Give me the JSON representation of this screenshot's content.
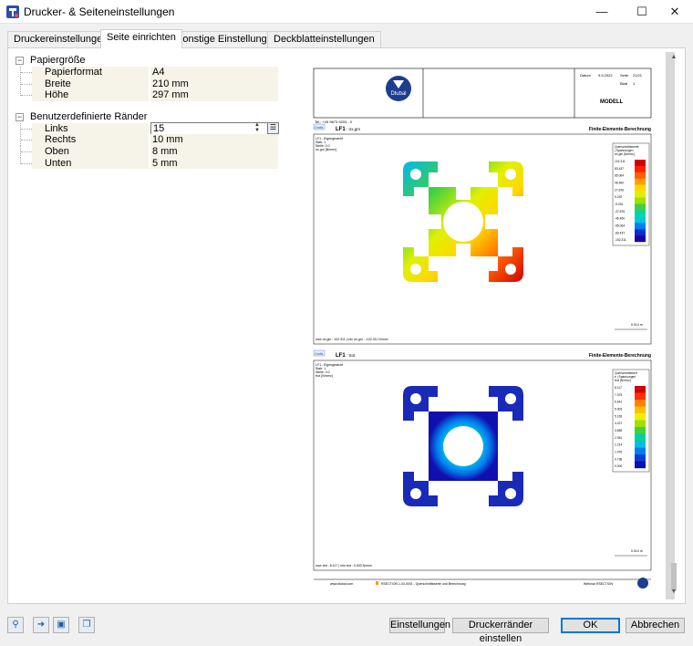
{
  "window": {
    "title": "Drucker- & Seiteneinstellungen",
    "minimize_glyph": "—",
    "maximize_glyph": "☐",
    "close_glyph": "✕"
  },
  "tabs": [
    {
      "label": "Druckereinstellungen"
    },
    {
      "label": "Seite einrichten"
    },
    {
      "label": "Sonstige Einstellungen"
    },
    {
      "label": "Deckblatteinstellungen"
    }
  ],
  "tree": {
    "paper": {
      "label": "Papiergröße",
      "toggle": "−",
      "rows": [
        {
          "key": "Papierformat",
          "value": "A4"
        },
        {
          "key": "Breite",
          "value": "210 mm"
        },
        {
          "key": "Höhe",
          "value": "297 mm"
        }
      ]
    },
    "margins": {
      "label": "Benutzerdefinierte Ränder",
      "toggle": "−",
      "rows": [
        {
          "key": "Links",
          "value": "15"
        },
        {
          "key": "Rechts",
          "value": "10 mm"
        },
        {
          "key": "Oben",
          "value": "8 mm"
        },
        {
          "key": "Unten",
          "value": "5 mm"
        }
      ]
    }
  },
  "preview": {
    "header": {
      "company": "Dlubal",
      "tel": "Tel.: +49 9673 9203 - 0",
      "datum_label": "Datum",
      "datum_value": "9.5.2022",
      "seite_label": "Seite",
      "seite_value": "21/21",
      "blatt_label": "Blatt",
      "blatt_value": "1",
      "modell": "MODELL"
    },
    "section1": {
      "badge": "Grafik",
      "lf": "LF1",
      "sym": ": σx,gm",
      "right": "Finite-Elemente-Berechnung",
      "info": [
        "LF1 - Eigengewicht",
        "Stab: 1",
        "Stelle: 0.0",
        "σx,gm [N/mm²]"
      ],
      "legend_title": [
        "Querschnittswerte",
        "| Spannungen",
        "σx,gm [N/mm²]"
      ],
      "legend_values": [
        "102.311",
        "83.437",
        "65.064",
        "46.460",
        "27.876",
        "9.292",
        "-9.292",
        "-27.876",
        "-46.460",
        "-65.064",
        "-83.437",
        "-102.311"
      ],
      "colors": [
        "#d40000",
        "#ff2000",
        "#ff6000",
        "#ffa000",
        "#ffd800",
        "#e0f000",
        "#a0e000",
        "#40d040",
        "#00d8a0",
        "#00c8e0",
        "#0080f0",
        "#0030d0",
        "#2000a0"
      ],
      "scale": "0.014 m",
      "footer": "max σx,gm : 102.311 | min σx,gm : -102.311 N/mm²"
    },
    "section2": {
      "badge": "Grafik",
      "lf": "LF1",
      "sym": ": τtot",
      "right": "Finite-Elemente-Berechnung",
      "info": [
        "LF1 - Eigengewicht",
        "Stab: 1",
        "Stelle: 0.0",
        "τtot [N/mm²]"
      ],
      "legend_title": [
        "Querschnittswert",
        "e | Spannungen",
        "τtot [N/mm²]"
      ],
      "legend_values": [
        "8.117",
        "7.379",
        "6.641",
        "5.903",
        "5.165",
        "4.427",
        "3.689",
        "2.951",
        "2.214",
        "1.476",
        "0.738",
        "0.000"
      ],
      "colors": [
        "#d40000",
        "#ff3000",
        "#ff8000",
        "#ffc000",
        "#f0f000",
        "#a0e000",
        "#40d040",
        "#00d0a0",
        "#00c0e0",
        "#0080f0",
        "#0040d8",
        "#1010b0"
      ],
      "scale": "0.014 m",
      "footer": "max τtot : 8.117 | min τtot : 0.000 N/mm²"
    },
    "page_footer": {
      "web": "www.dlubal.com",
      "product": "RSECTION 1.03.0001 - Querschnittswerte und Berechnung",
      "right": "Webinar RSECTION"
    }
  },
  "footer": {
    "settings": "Einstellungen",
    "margins": "Druckerränder einstellen",
    "ok": "OK",
    "cancel": "Abbrechen"
  }
}
